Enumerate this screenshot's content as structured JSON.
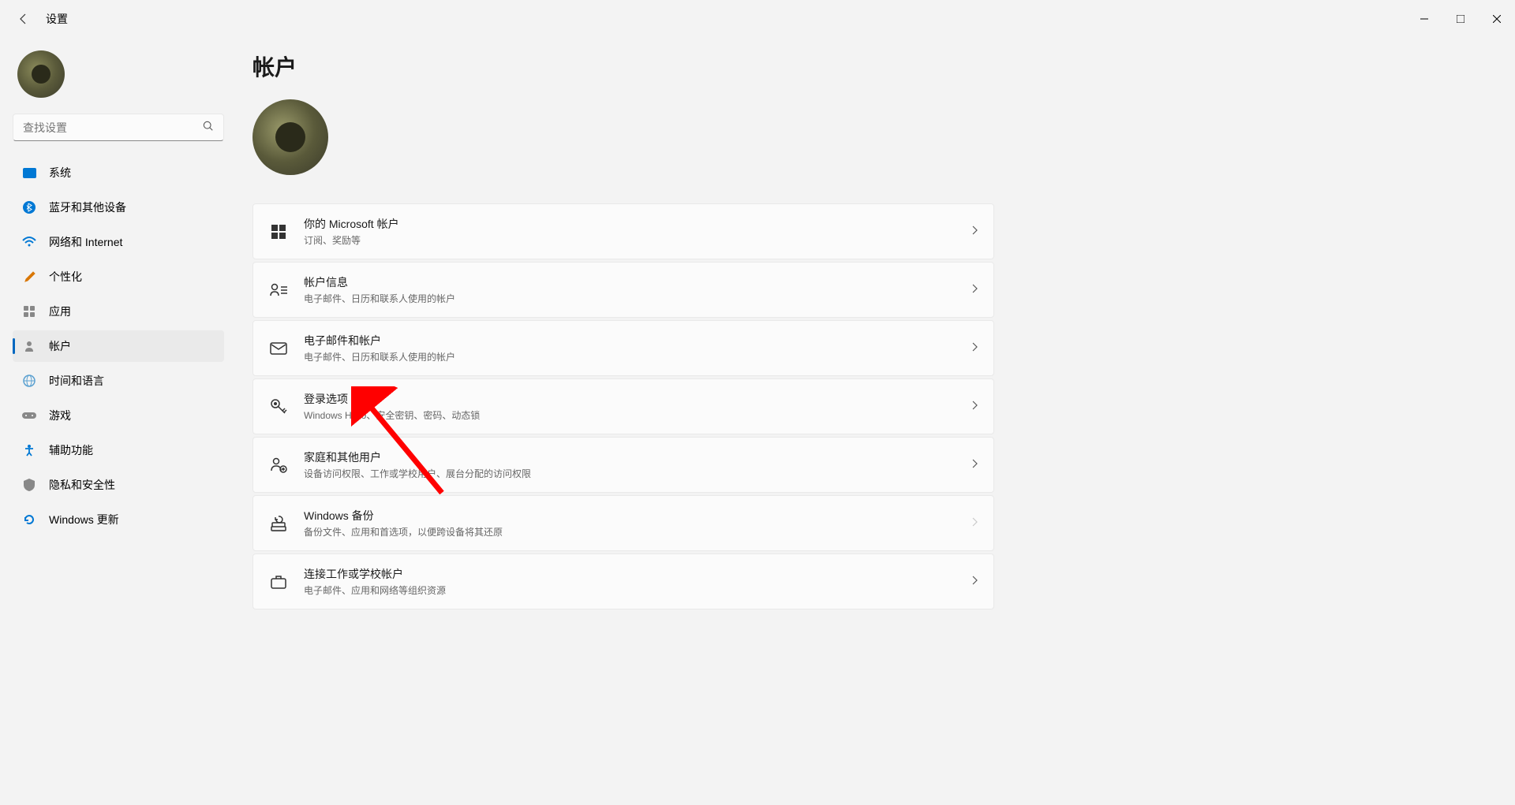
{
  "app": {
    "title": "设置"
  },
  "search": {
    "placeholder": "查找设置"
  },
  "sidebar": {
    "items": [
      {
        "label": "系统",
        "icon": "💻",
        "color": "#0078d4"
      },
      {
        "label": "蓝牙和其他设备",
        "icon": "bluetooth"
      },
      {
        "label": "网络和 Internet",
        "icon": "📶"
      },
      {
        "label": "个性化",
        "icon": "🖌️"
      },
      {
        "label": "应用",
        "icon": "▦"
      },
      {
        "label": "帐户",
        "icon": "👤"
      },
      {
        "label": "时间和语言",
        "icon": "🌐"
      },
      {
        "label": "游戏",
        "icon": "🎮"
      },
      {
        "label": "辅助功能",
        "icon": "accessibility"
      },
      {
        "label": "隐私和安全性",
        "icon": "🛡️"
      },
      {
        "label": "Windows 更新",
        "icon": "🔄"
      }
    ],
    "activeIndex": 5
  },
  "page": {
    "title": "帐户"
  },
  "settings": [
    {
      "title": "你的 Microsoft 帐户",
      "desc": "订阅、奖励等",
      "icon": "microsoft"
    },
    {
      "title": "帐户信息",
      "desc": "电子邮件、日历和联系人使用的帐户",
      "icon": "person-detail"
    },
    {
      "title": "电子邮件和帐户",
      "desc": "电子邮件、日历和联系人使用的帐户",
      "icon": "mail"
    },
    {
      "title": "登录选项",
      "desc": "Windows Hello、安全密钥、密码、动态锁",
      "icon": "key"
    },
    {
      "title": "家庭和其他用户",
      "desc": "设备访问权限、工作或学校用户、展台分配的访问权限",
      "icon": "family"
    },
    {
      "title": "Windows 备份",
      "desc": "备份文件、应用和首选项，以便跨设备将其还原",
      "icon": "backup"
    },
    {
      "title": "连接工作或学校帐户",
      "desc": "电子邮件、应用和网络等组织资源",
      "icon": "briefcase"
    }
  ]
}
